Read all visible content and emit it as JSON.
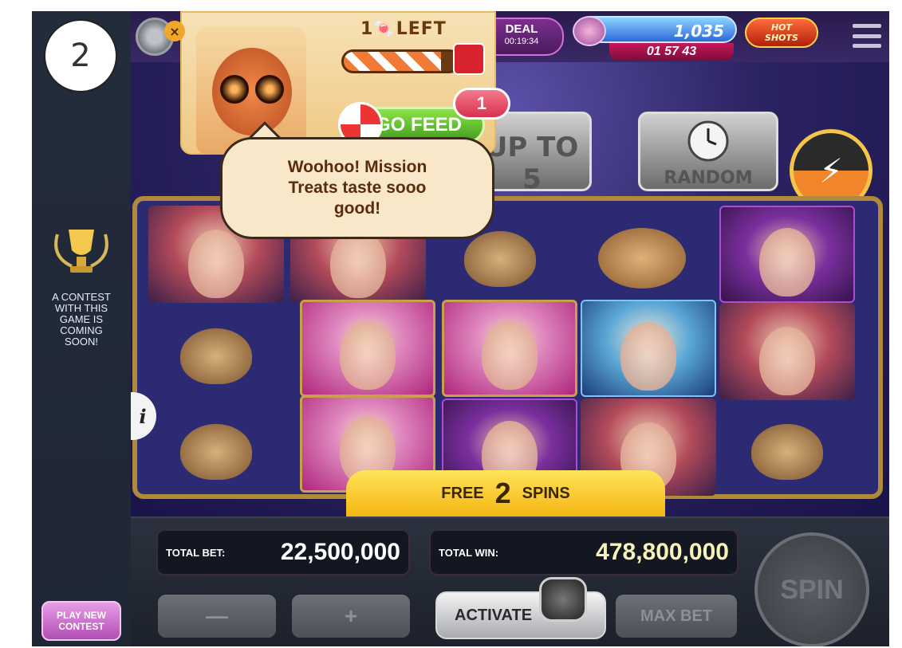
{
  "step_number": "2",
  "sidebar": {
    "contest_text": "A CONTEST\nWITH THIS\nGAME IS\nCOMING\nSOON!",
    "play_new_contest_label": "PLAY NEW\nCONTEST"
  },
  "topbar": {
    "close_glyph": "×",
    "deal_title": "DEAL",
    "deal_timer": "00:19:34",
    "balance": "1,035",
    "bonus_timer": "01 57 43",
    "hot_shots_label": "HOT\nSHOTS"
  },
  "mission_popup": {
    "left_label": "1🍬LEFT",
    "progress": 0.85,
    "go_feed_label": "GO FEED",
    "feed_badge_count": "1",
    "speech_text": "Woohoo! Mission\nTreats taste sooo\ngood!"
  },
  "features": {
    "up_to_5_label": "UP TO 5",
    "random_label": "RANDOM"
  },
  "reels": {
    "rows": [
      [
        "woman-red-hat",
        "woman-redhead",
        "mouse",
        "birds",
        "woman-purple"
      ],
      [
        "mouse",
        "blonde",
        "blonde",
        "fairy",
        "woman-red-rose"
      ],
      [
        "mouse",
        "blonde",
        "woman-purple",
        "woman-red-rose",
        "mouse"
      ]
    ]
  },
  "info_label": "i",
  "free_spins": {
    "word_free": "FREE",
    "count": "2",
    "word_spins": "SPINS"
  },
  "controls": {
    "total_bet_label": "TOTAL BET:",
    "total_bet_value": "22,500,000",
    "total_win_label": "TOTAL WIN:",
    "total_win_value": "478,800,000",
    "minus_label": "—",
    "plus_label": "+",
    "activate_label": "ACTIVATE",
    "max_bet_label": "MAX BET",
    "spin_label": "SPIN"
  }
}
